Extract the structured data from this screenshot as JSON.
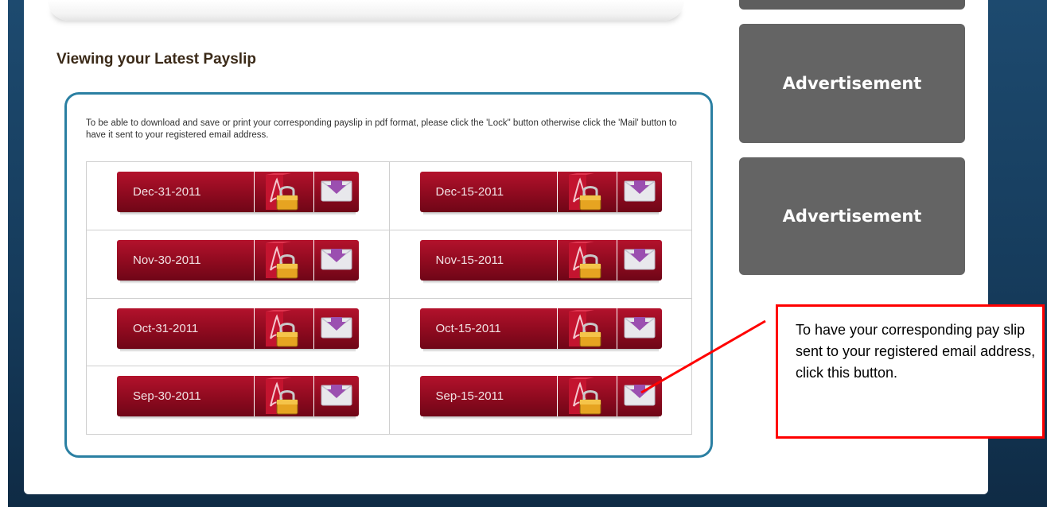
{
  "page": {
    "title": "Viewing your Latest Payslip",
    "instructions": "To be able to download and save or print your corresponding payslip in pdf format, please click the 'Lock\" button otherwise click the 'Mail' button to have it sent to your registered email address."
  },
  "payslips": [
    {
      "date": "Dec-31-2011"
    },
    {
      "date": "Dec-15-2011"
    },
    {
      "date": "Nov-30-2011"
    },
    {
      "date": "Nov-15-2011"
    },
    {
      "date": "Oct-31-2011"
    },
    {
      "date": "Oct-15-2011"
    },
    {
      "date": "Sep-30-2011"
    },
    {
      "date": "Sep-15-2011"
    }
  ],
  "sidebar": {
    "ads": [
      "Advertisement",
      "Advertisement"
    ]
  },
  "callout": {
    "text": "To have your corresponding pay slip sent to your registered email address, click this button."
  },
  "icons": {
    "lock": "pdf-lock-icon",
    "mail": "mail-download-icon"
  },
  "colors": {
    "button_red": "#8e0a1f",
    "panel_border": "#2a7fa2",
    "callout_border": "#ff0000",
    "ad_background": "#646464",
    "page_background": "#1d4a6f"
  }
}
